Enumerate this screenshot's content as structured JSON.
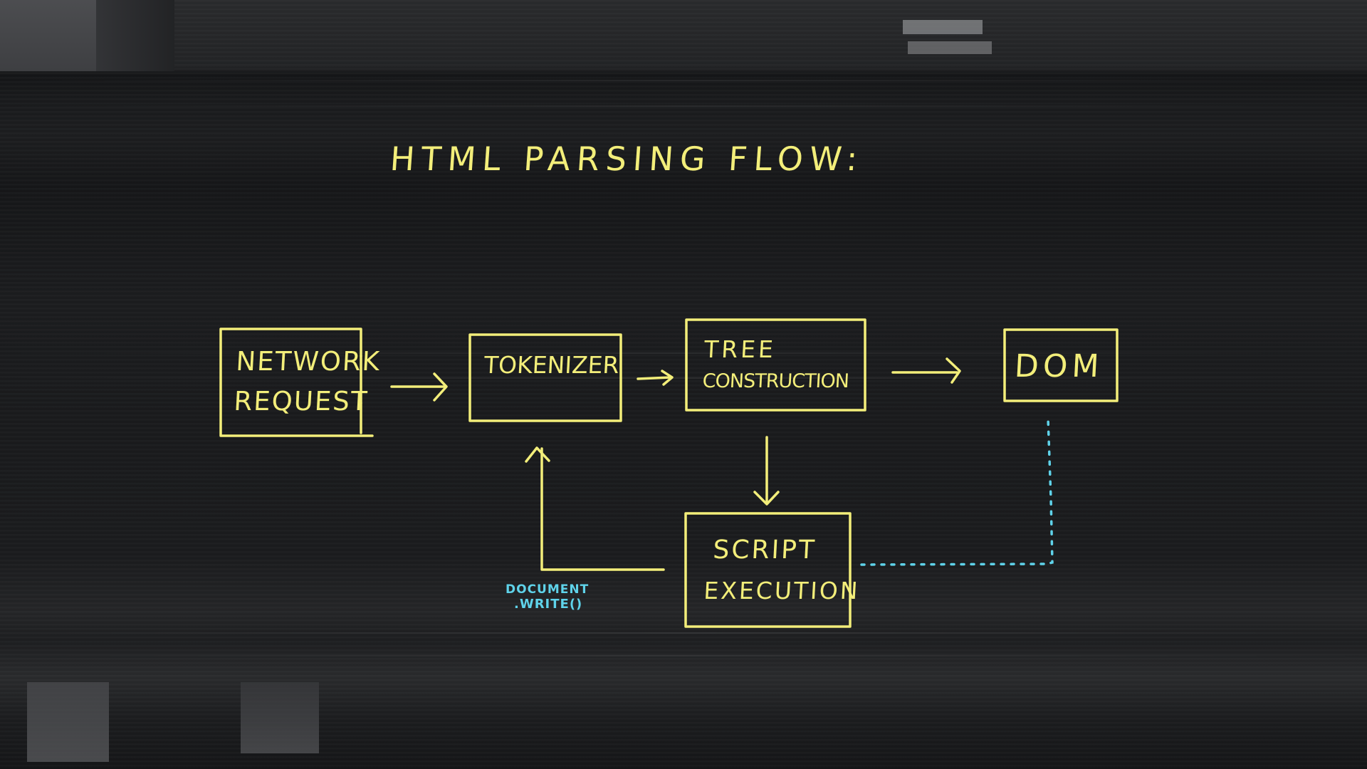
{
  "title": "HTML PARSING FLOW:",
  "colors": {
    "background": "#1b1c1e",
    "ink_primary": "#f3ee7a",
    "ink_secondary": "#5fd3ea"
  },
  "nodes": {
    "network_request": {
      "line1": "NETWORK",
      "line2": "REQUEST"
    },
    "tokenizer": {
      "line1": "TOKENIZER"
    },
    "tree_construction": {
      "line1": "TREE",
      "line2": "CONSTRUCTION"
    },
    "dom": {
      "line1": "DOM"
    },
    "script_execution": {
      "line1": "SCRIPT",
      "line2": "EXECUTION"
    }
  },
  "edges": [
    {
      "from": "network_request",
      "to": "tokenizer",
      "style": "solid"
    },
    {
      "from": "tokenizer",
      "to": "tree_construction",
      "style": "solid"
    },
    {
      "from": "tree_construction",
      "to": "dom",
      "style": "solid"
    },
    {
      "from": "tree_construction",
      "to": "script_execution",
      "style": "solid"
    },
    {
      "from": "script_execution",
      "to": "tokenizer",
      "style": "solid",
      "label": "document.write()"
    },
    {
      "from": "script_execution",
      "to": "dom",
      "style": "dotted"
    }
  ],
  "annotations": {
    "document_write": {
      "line1": "DOCUMENT",
      "line2": ".WRITE()"
    }
  }
}
